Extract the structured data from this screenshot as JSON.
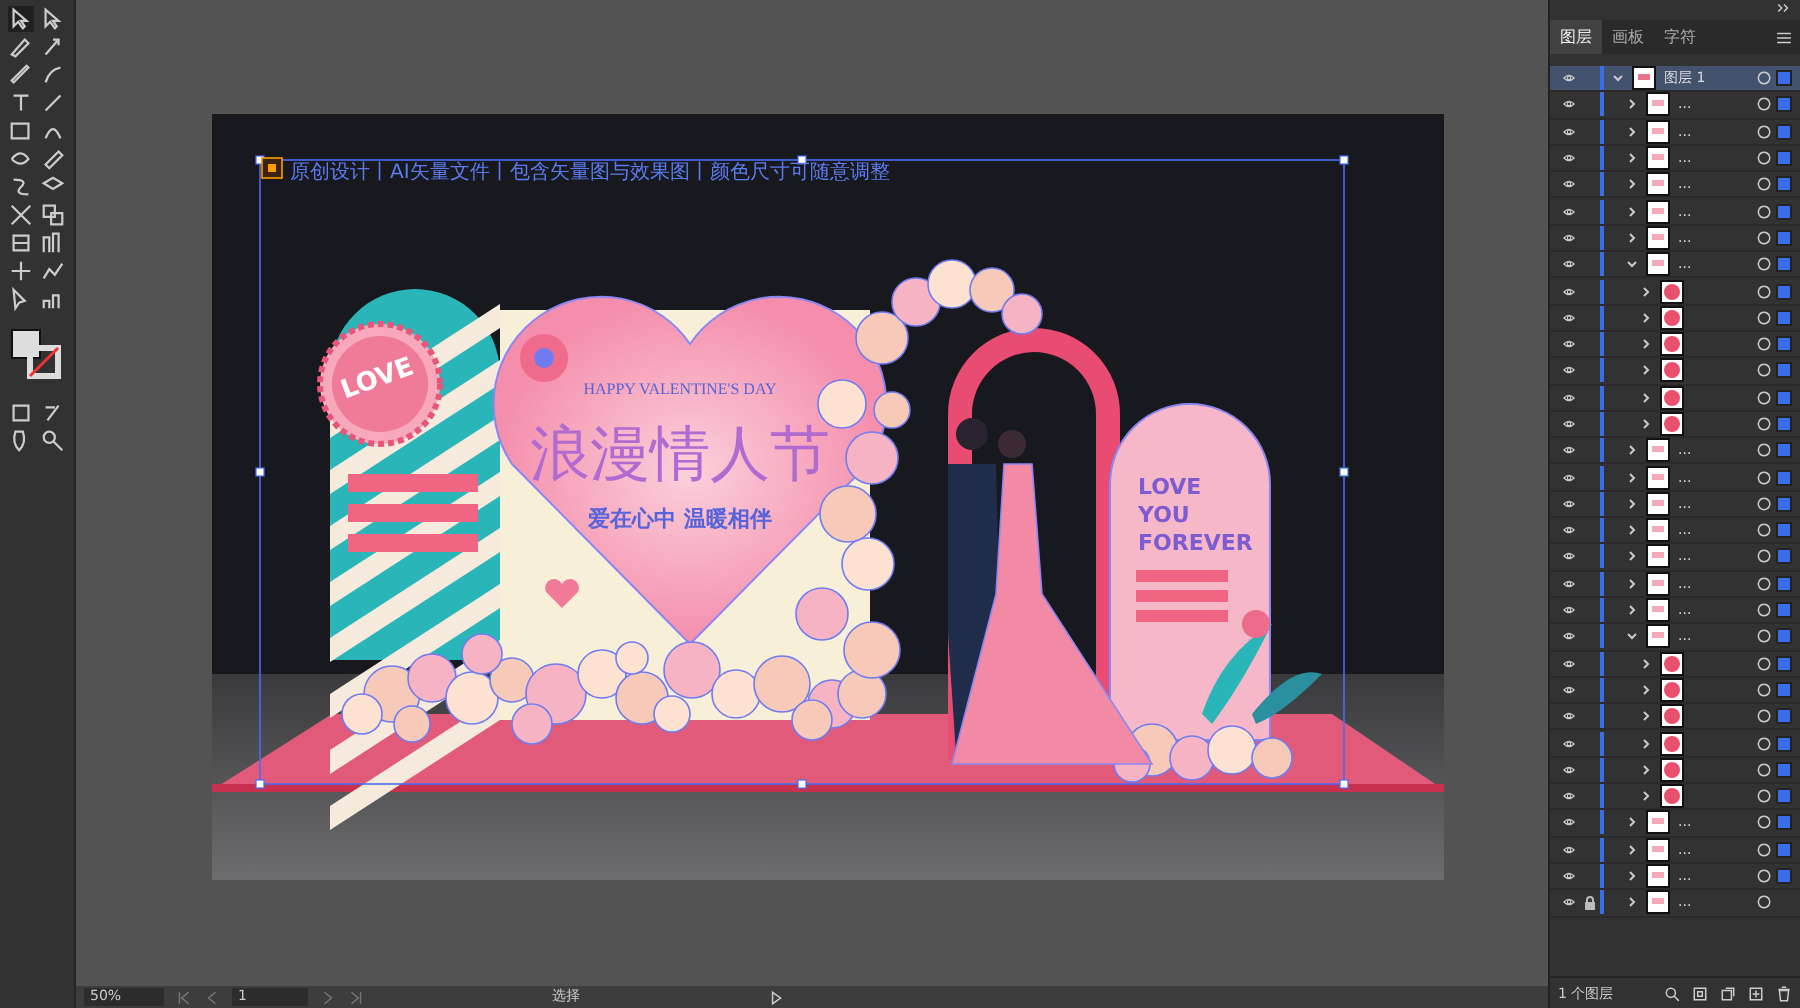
{
  "banner": {
    "text": "原创设计丨AI矢量文件丨包含矢量图与效果图丨颜色尺寸可随意调整"
  },
  "artwork": {
    "badge": "LOVE",
    "subtitle": "HAPPY VALENTINE'S DAY",
    "title": "浪漫情人节",
    "slogan": "爱在心中  温暖相伴",
    "side_text": [
      "LOVE",
      "YOU",
      "FOREVER"
    ]
  },
  "layers_panel": {
    "tabs": [
      {
        "label": "图层",
        "selected": true
      },
      {
        "label": "画板",
        "selected": false
      },
      {
        "label": "字符",
        "selected": false
      }
    ],
    "layers": [
      {
        "kind": "layer",
        "name": "图层 1",
        "expanded": true,
        "selected": true,
        "locked": false,
        "children": [
          {
            "kind": "group",
            "name": "...",
            "expanded": false,
            "selected": true,
            "locked": false
          },
          {
            "kind": "group",
            "name": "...",
            "expanded": false,
            "selected": true,
            "locked": false
          },
          {
            "kind": "group",
            "name": "...",
            "expanded": false,
            "selected": true,
            "locked": false
          },
          {
            "kind": "group",
            "name": "...",
            "expanded": false,
            "selected": true,
            "locked": false
          },
          {
            "kind": "group",
            "name": "...",
            "expanded": false,
            "selected": true,
            "locked": false
          },
          {
            "kind": "group",
            "name": "...",
            "expanded": false,
            "selected": true,
            "locked": false
          },
          {
            "kind": "group",
            "name": "...",
            "expanded": true,
            "selected": true,
            "locked": false,
            "children": [
              {
                "kind": "path",
                "expanded": false,
                "selected": true,
                "locked": false
              },
              {
                "kind": "path",
                "expanded": false,
                "selected": true,
                "locked": false
              },
              {
                "kind": "path",
                "expanded": false,
                "selected": true,
                "locked": false
              },
              {
                "kind": "path",
                "expanded": false,
                "selected": true,
                "locked": false
              },
              {
                "kind": "path",
                "expanded": false,
                "selected": true,
                "locked": false
              },
              {
                "kind": "path",
                "expanded": false,
                "selected": true,
                "locked": false
              }
            ]
          },
          {
            "kind": "group",
            "name": "...",
            "expanded": false,
            "selected": true,
            "locked": false
          },
          {
            "kind": "group",
            "name": "...",
            "expanded": false,
            "selected": true,
            "locked": false
          },
          {
            "kind": "group",
            "name": "...",
            "expanded": false,
            "selected": true,
            "locked": false
          },
          {
            "kind": "group",
            "name": "...",
            "expanded": false,
            "selected": true,
            "locked": false
          },
          {
            "kind": "group",
            "name": "...",
            "expanded": false,
            "selected": true,
            "locked": false
          },
          {
            "kind": "group",
            "name": "...",
            "expanded": false,
            "selected": true,
            "locked": false
          },
          {
            "kind": "group",
            "name": "...",
            "expanded": false,
            "selected": true,
            "locked": false
          },
          {
            "kind": "group",
            "name": "...",
            "expanded": true,
            "selected": true,
            "locked": false,
            "children": [
              {
                "kind": "path",
                "expanded": false,
                "selected": true,
                "locked": false
              },
              {
                "kind": "path",
                "expanded": false,
                "selected": true,
                "locked": false
              },
              {
                "kind": "path",
                "expanded": false,
                "selected": true,
                "locked": false
              },
              {
                "kind": "path",
                "expanded": false,
                "selected": true,
                "locked": false
              },
              {
                "kind": "path",
                "expanded": false,
                "selected": true,
                "locked": false
              },
              {
                "kind": "path",
                "expanded": false,
                "selected": true,
                "locked": false
              }
            ]
          },
          {
            "kind": "group",
            "name": "...",
            "expanded": false,
            "selected": true,
            "locked": false
          },
          {
            "kind": "group",
            "name": "...",
            "expanded": false,
            "selected": true,
            "locked": false
          },
          {
            "kind": "group",
            "name": "...",
            "expanded": false,
            "selected": true,
            "locked": false
          },
          {
            "kind": "group",
            "name": "...",
            "expanded": false,
            "selected": false,
            "locked": true
          }
        ]
      }
    ],
    "footer": "1 个图层"
  },
  "status_bar": {
    "zoom": "50%",
    "artboard": "1",
    "tool": "选择"
  }
}
